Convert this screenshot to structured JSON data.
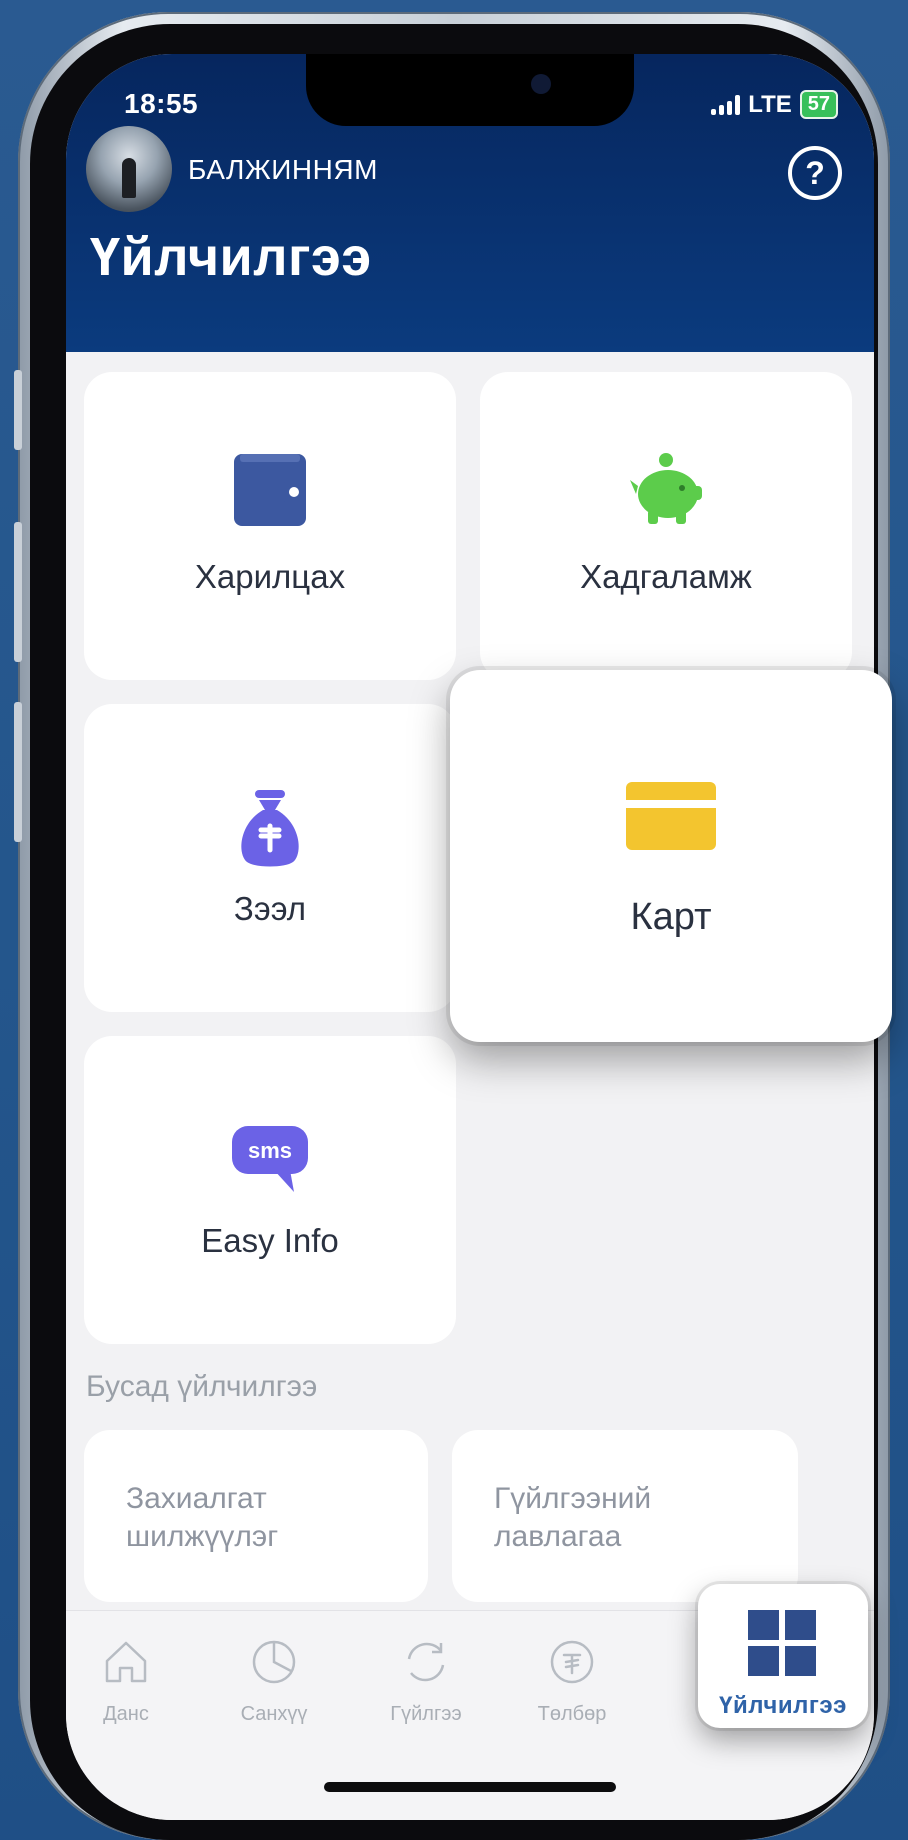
{
  "status_bar": {
    "time": "18:55",
    "network": "LTE",
    "battery": "57"
  },
  "header": {
    "user_name": "БАЛЖИННЯМ",
    "help": "?",
    "title": "Үйлчилгээ"
  },
  "services": [
    {
      "label": "Харилцах",
      "icon": "wallet-icon",
      "color": "#3c58a0"
    },
    {
      "label": "Хадгаламж",
      "icon": "piggy-bank-icon",
      "color": "#5ccc4b"
    },
    {
      "label": "Зээл",
      "icon": "money-bag-icon",
      "color": "#6b62e6"
    },
    {
      "label": "Карт",
      "icon": "card-icon",
      "color": "#f3c52f"
    },
    {
      "label": "Easy Info",
      "icon": "sms-icon",
      "color": "#6b62e6",
      "icon_text": "sms"
    }
  ],
  "other_section": {
    "title": "Бусад үйлчилгээ",
    "items": [
      {
        "line1": "Захиалгат",
        "line2": "шилжүүлэг"
      },
      {
        "line1": "Гүйлгээний",
        "line2": "лавлагаа"
      }
    ]
  },
  "tabbar": {
    "tabs": [
      {
        "label": "Данс",
        "icon": "home-icon"
      },
      {
        "label": "Санхүү",
        "icon": "pie-chart-icon"
      },
      {
        "label": "Гүйлгээ",
        "icon": "refresh-icon"
      },
      {
        "label": "Төлбөр",
        "icon": "tugrik-coin-icon"
      },
      {
        "label": "Үйлчилгээ",
        "icon": "grid-icon",
        "active": true
      }
    ],
    "active_color": "#2f63a8"
  }
}
